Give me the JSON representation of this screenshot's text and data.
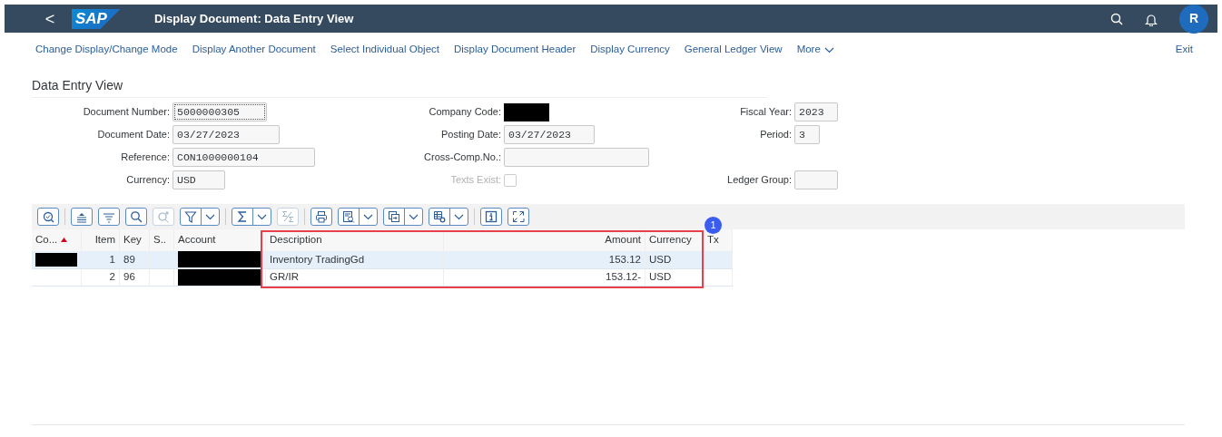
{
  "shell": {
    "back": "<",
    "logo": "SAP",
    "title": "Display Document: Data Entry View",
    "avatar": "R"
  },
  "actions": [
    "Change Display/Change Mode",
    "Display Another Document",
    "Select Individual Object",
    "Display Document Header",
    "Display Currency",
    "General Ledger View"
  ],
  "more": "More",
  "exit": "Exit",
  "section_title": "Data Entry View",
  "form": [
    {
      "label": "Document Number:",
      "value": "5000000305",
      "kind": "input",
      "focused": true
    },
    {
      "label": "Company Code:",
      "kind": "input",
      "redacted": true
    },
    {
      "label": "Fiscal Year:",
      "value": "2023",
      "kind": "input"
    },
    {
      "label": "Document Date:",
      "value": "03/27/2023",
      "kind": "input"
    },
    {
      "label": "Posting Date:",
      "value": "03/27/2023",
      "kind": "input"
    },
    {
      "label": "Period:",
      "value": "3",
      "kind": "input"
    },
    {
      "label": "Reference:",
      "value": "CON1000000104",
      "kind": "input"
    },
    {
      "label": "Cross-Comp.No.:",
      "kind": "input"
    },
    {
      "kind": "blank"
    },
    {
      "label": "Currency:",
      "value": "USD",
      "kind": "input"
    },
    {
      "label": "Texts Exist:",
      "kind": "checkbox",
      "checked": false,
      "disabled": true
    },
    {
      "label": "Ledger Group:",
      "kind": "input"
    }
  ],
  "toolbar_groups": [
    [
      {
        "kind": "button",
        "disabled": false
      }
    ],
    [
      {
        "kind": "button",
        "disabled": false
      },
      {
        "kind": "button",
        "disabled": false
      },
      {
        "kind": "button",
        "disabled": false
      },
      {
        "kind": "button",
        "disabled": true
      },
      {
        "kind": "split",
        "disabled": false
      }
    ],
    [
      {
        "kind": "split",
        "disabled": false
      },
      {
        "kind": "button",
        "disabled": true
      }
    ],
    [
      {
        "kind": "button",
        "disabled": false
      },
      {
        "kind": "split",
        "disabled": false
      },
      {
        "kind": "split",
        "disabled": false
      },
      {
        "kind": "split",
        "disabled": false
      }
    ],
    [
      {
        "kind": "button",
        "disabled": false
      },
      {
        "kind": "button",
        "disabled": false
      }
    ]
  ],
  "table": {
    "columns": [
      {
        "label": "Co...",
        "sorted": true
      },
      {
        "label": "Item",
        "sorted": false
      },
      {
        "label": "Key",
        "sorted": false
      },
      {
        "label": "S..",
        "sorted": false
      },
      {
        "label": "Account",
        "sorted": false
      },
      {
        "label": "Description",
        "sorted": false
      },
      {
        "label": "Amount",
        "sorted": false
      },
      {
        "label": "Currency",
        "sorted": false
      },
      {
        "label": "Tx",
        "sorted": false
      }
    ],
    "rows": [
      {
        "selected": true,
        "cells": [
          {
            "redacted": true
          },
          {
            "text": "1"
          },
          {
            "text": "89"
          },
          {
            "redacted": false
          },
          {
            "redacted": true
          },
          {
            "text": "Inventory TradingGd"
          },
          {
            "text": "153.12"
          },
          {
            "text": "USD"
          },
          {
            "redacted": false
          }
        ]
      },
      {
        "selected": false,
        "cells": [
          {
            "redacted": false
          },
          {
            "text": "2"
          },
          {
            "text": "96"
          },
          {
            "redacted": false
          },
          {
            "redacted": true
          },
          {
            "text": "GR/IR"
          },
          {
            "text": "153.12-"
          },
          {
            "text": "USD"
          },
          {
            "redacted": false
          }
        ]
      }
    ]
  },
  "annotation": {
    "badge": "1"
  }
}
